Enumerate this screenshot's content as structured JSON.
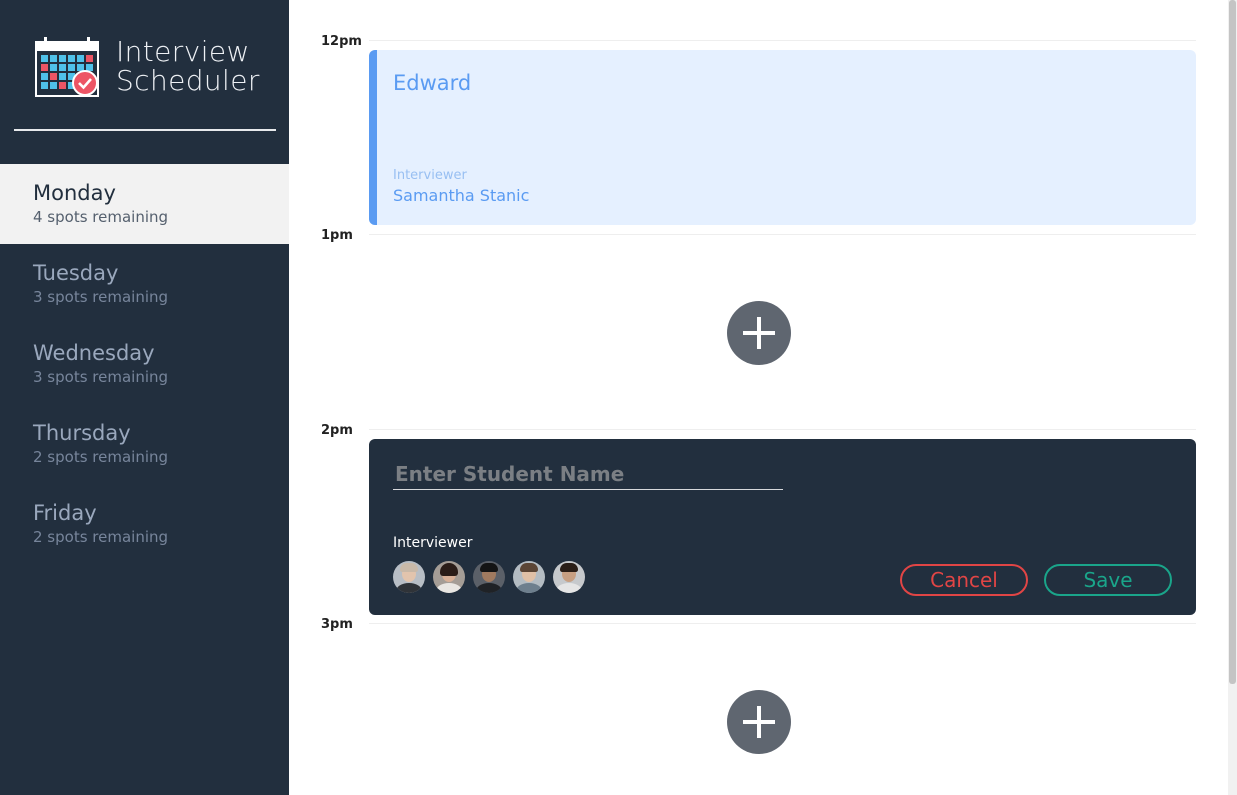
{
  "brand": {
    "line1": "Interview",
    "line2": "Scheduler"
  },
  "days": [
    {
      "name": "Monday",
      "spots": "4 spots remaining",
      "selected": true
    },
    {
      "name": "Tuesday",
      "spots": "3 spots remaining",
      "selected": false
    },
    {
      "name": "Wednesday",
      "spots": "3 spots remaining",
      "selected": false
    },
    {
      "name": "Thursday",
      "spots": "2 spots remaining",
      "selected": false
    },
    {
      "name": "Friday",
      "spots": "2 spots remaining",
      "selected": false
    }
  ],
  "schedule": {
    "times": [
      "12pm",
      "1pm",
      "2pm",
      "3pm"
    ],
    "appointment": {
      "student": "Edward",
      "interviewer_label": "Interviewer",
      "interviewer_name": "Samantha Stanic"
    },
    "form": {
      "placeholder": "Enter Student Name",
      "interviewer_label": "Interviewer",
      "cancel_label": "Cancel",
      "save_label": "Save"
    }
  },
  "colors": {
    "sidebar": "#222f3e",
    "appointment_accent": "#5a9bf2",
    "cancel": "#e14545",
    "save": "#1aa58a"
  },
  "icons": {
    "logo": "calendar-icon",
    "add": "plus-icon"
  }
}
